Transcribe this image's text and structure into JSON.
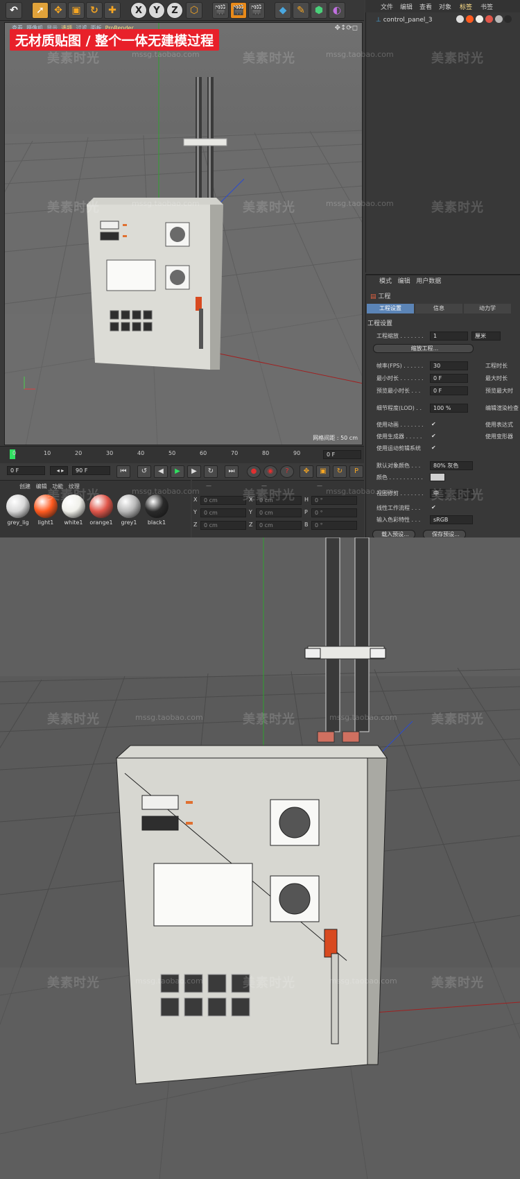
{
  "banner": "无材质贴图 / 整个一体无建模过程",
  "toolbar": {
    "axis_x": "X",
    "axis_y": "Y",
    "axis_z": "Z"
  },
  "viewport": {
    "menu": [
      "查看",
      "摄像机",
      "显示",
      "选项",
      "过滤",
      "面板",
      "ProRender"
    ],
    "grid_spacing": "网格间距 : 50 cm"
  },
  "side_menu": [
    "文件",
    "编辑",
    "查看",
    "对象",
    "标签",
    "书签"
  ],
  "object_manager": {
    "object_name": "control_panel_3"
  },
  "attr": {
    "menu": [
      "模式",
      "编辑",
      "用户数据"
    ],
    "section_title": "工程",
    "tabs": [
      "工程设置",
      "信息",
      "动力学"
    ],
    "group_title": "工程设置",
    "project_scale_label": "工程缩放 . . . . . . .",
    "project_scale_value": "1",
    "project_scale_unit": "厘米",
    "scale_button": "缩放工程...",
    "fps_label": "帧率(FPS) . . . . . .",
    "fps_value": "30",
    "project_time_label": "工程时长",
    "min_time_label": "最小时长 . . . . . . .",
    "min_time_value": "0 F",
    "max_time_label": "最大时长",
    "preview_min_label": "预览最小时长 . . .",
    "preview_min_value": "0 F",
    "preview_max_label": "预览最大时",
    "lod_label": "细节程度(LOD) . .",
    "lod_value": "100 %",
    "edit_render_label": "编辑渲染检查",
    "use_anim_label": "使用动画 . . . . . . .",
    "use_expr_label": "使用表达式",
    "use_gen_label": "使用生成器 . . . . .",
    "use_deform_label": "使用变形器",
    "use_motion_label": "使用运动剪辑系统",
    "default_color_label": "默认对象颜色 . . .",
    "default_color_value": "80% 灰色",
    "color_label": "颜色 . . . . . . . . . .",
    "view_clip_label": "视图修剪 . . . . . . .",
    "view_clip_value": "中",
    "linear_label": "线性工作流程 . . .",
    "input_color_label": "输入色彩特性 . . .",
    "input_color_value": "sRGB",
    "bottom_btn1": "载入预设...",
    "bottom_btn2": "保存预设..."
  },
  "timeline": {
    "ticks": [
      "0",
      "10",
      "20",
      "30",
      "40",
      "50",
      "60",
      "70",
      "80",
      "90"
    ],
    "current_frame": "0 F",
    "start_field": "0 F",
    "end_field": "90 F"
  },
  "material_manager": {
    "menu": [
      "创建",
      "编辑",
      "功能",
      "纹理"
    ],
    "materials": [
      {
        "name": "grey_lig",
        "color": "#d8d8d8"
      },
      {
        "name": "light1",
        "color": "#ff5a1f"
      },
      {
        "name": "white1",
        "color": "#f0f0ea"
      },
      {
        "name": "orange1",
        "color": "#e0564a"
      },
      {
        "name": "grey1",
        "color": "#b8b8b8"
      },
      {
        "name": "black1",
        "color": "#2a2a2a"
      }
    ]
  },
  "coord_manager": {
    "headers": [
      "—",
      "—",
      "—"
    ],
    "rows": [
      {
        "a": "X",
        "av": "0 cm",
        "b": "X",
        "bv": "0 cm",
        "c": "H",
        "cv": "0 °"
      },
      {
        "a": "Y",
        "av": "0 cm",
        "b": "Y",
        "bv": "0 cm",
        "c": "P",
        "cv": "0 °"
      },
      {
        "a": "Z",
        "av": "0 cm",
        "b": "Z",
        "bv": "0 cm",
        "c": "B",
        "cv": "0 °"
      }
    ]
  },
  "watermark": {
    "brand": "美素时光",
    "url": "mssg.taobao.com"
  },
  "colors": {
    "accent_orange": "#e88a1a",
    "banner_red": "#e8202a",
    "tab_blue": "#5b84b6"
  }
}
